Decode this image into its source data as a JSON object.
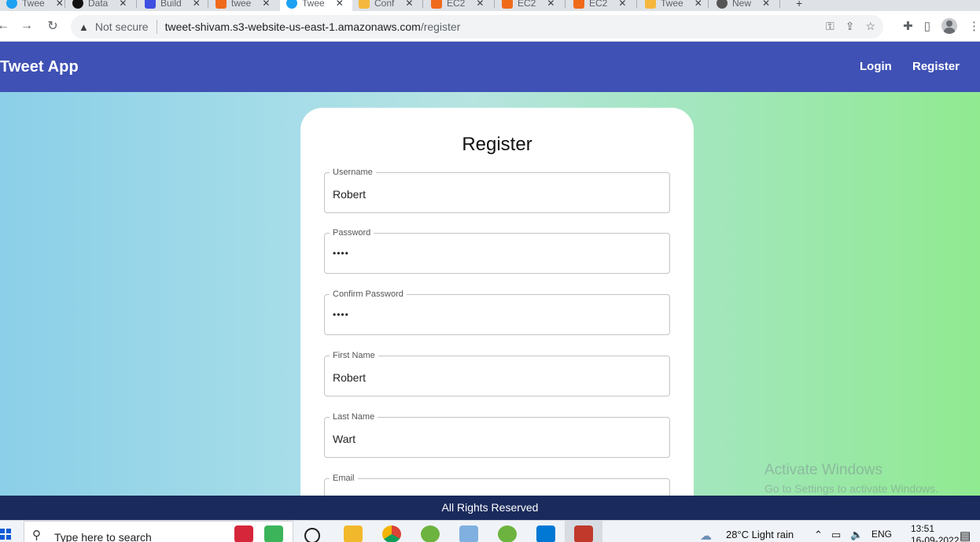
{
  "browser": {
    "tabs": [
      {
        "label": "Twee",
        "color": "#1da1f2"
      },
      {
        "label": "Data",
        "color": "#111111"
      },
      {
        "label": "Build",
        "color": "#3f51e0"
      },
      {
        "label": "twee",
        "color": "#f06a1c"
      },
      {
        "label": "Twee",
        "color": "#1da1f2",
        "active": true
      },
      {
        "label": "Conf",
        "color": "#f5b83d"
      },
      {
        "label": "EC2",
        "color": "#f06a1c"
      },
      {
        "label": "EC2",
        "color": "#f06a1c"
      },
      {
        "label": "EC2",
        "color": "#f06a1c"
      },
      {
        "label": "Twee",
        "color": "#f5b83d"
      },
      {
        "label": "New",
        "color": "#555555"
      }
    ],
    "security_label": "Not secure",
    "url_host": "tweet-shivam.s3-website-us-east-1.amazonaws.com",
    "url_path": "/register"
  },
  "app": {
    "brand": "Tweet App",
    "nav": {
      "login": "Login",
      "register": "Register"
    },
    "accent": "#3f51b5"
  },
  "form": {
    "title": "Register",
    "fields": [
      {
        "label": "Username",
        "value": "Robert",
        "type": "text"
      },
      {
        "label": "Password",
        "value": "••••",
        "type": "password"
      },
      {
        "label": "Confirm Password",
        "value": "••••",
        "type": "password"
      },
      {
        "label": "First Name",
        "value": "Robert",
        "type": "text"
      },
      {
        "label": "Last Name",
        "value": "Wart",
        "type": "text"
      },
      {
        "label": "Email",
        "value": "",
        "type": "text"
      }
    ]
  },
  "watermark": {
    "line1": "Activate Windows",
    "line2": "Go to Settings to activate Windows."
  },
  "footer": {
    "text": "All Rights Reserved"
  },
  "taskbar": {
    "search_placeholder": "Type here to search",
    "weather": "28°C  Light rain",
    "language": "ENG",
    "time": "13:51",
    "date": "16-09-2022"
  }
}
